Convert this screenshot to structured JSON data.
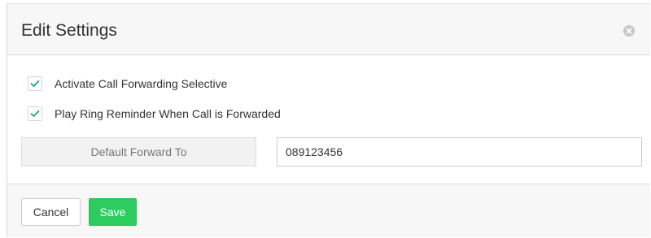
{
  "dialog": {
    "title": "Edit Settings",
    "close_icon": "close-circle-icon"
  },
  "options": [
    {
      "label": "Activate Call Forwarding Selective",
      "checked": true
    },
    {
      "label": "Play Ring Reminder When Call is Forwarded",
      "checked": true
    }
  ],
  "forward": {
    "label": "Default Forward To",
    "value": "089123456"
  },
  "footer": {
    "cancel_label": "Cancel",
    "save_label": "Save"
  },
  "colors": {
    "accent": "#2dcc5f",
    "check": "#1aa68f"
  }
}
